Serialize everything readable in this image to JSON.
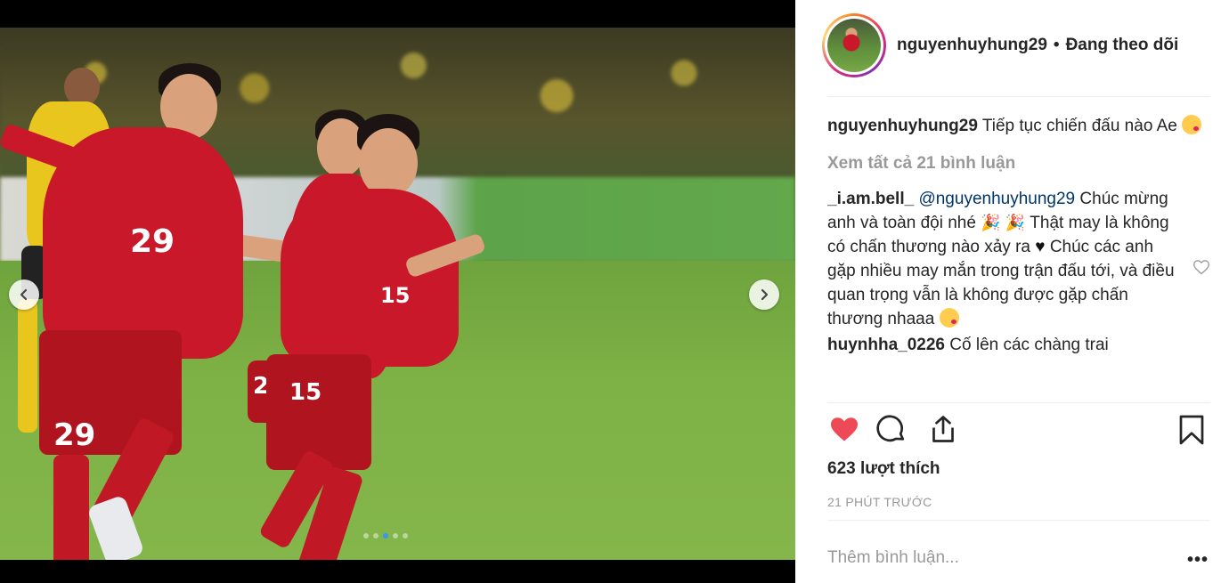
{
  "post": {
    "username": "nguyenhuyhung29",
    "separator": "•",
    "follow_status": "Đang theo dõi",
    "caption": {
      "username": "nguyenhuyhung29",
      "text": "Tiếp tục chiến đấu nào Ae"
    },
    "view_all_comments": "Xem tất cả 21 bình luận",
    "comments": [
      {
        "username": "_i.am.bell_",
        "mention": "@nguyenhuyhung29",
        "text_1": "Chúc mừng anh và toàn đội nhé",
        "text_2": "Thật may là không có chấn thương nào xảy ra",
        "text_3": "Chúc các anh gặp nhiều may mắn trong trận đấu tới, và điều quan trọng vẫn là không được gặp chấn thương nhaaa"
      },
      {
        "username": "huynhha_0226",
        "text": "Cố lên các chàng trai"
      }
    ],
    "likes": "623 lượt thích",
    "time_ago": "21 PHÚT TRƯỚC",
    "add_comment_placeholder": "Thêm bình luận...",
    "more_label": "•••"
  },
  "media": {
    "jersey_numbers": [
      "29",
      "29",
      "15",
      "15",
      "2"
    ],
    "carousel_dots": 5,
    "active_dot": 3
  },
  "colors": {
    "like_red": "#ed4956",
    "mention": "#003569",
    "muted": "#999999",
    "active_dot": "#3897f0"
  }
}
